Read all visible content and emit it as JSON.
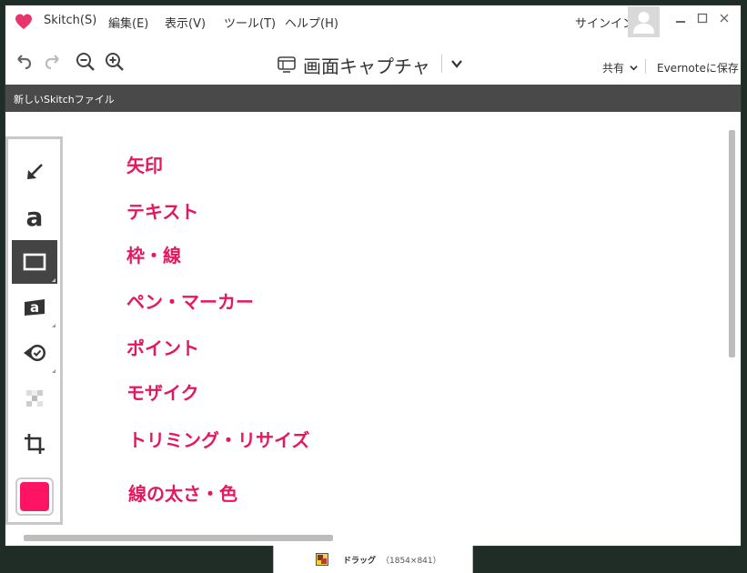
{
  "menubar": {
    "items": [
      "Skitch(S)",
      "編集(E)",
      "表示(V)",
      "ツール(T)",
      "ヘルプ(H)"
    ],
    "signin": "サインイン"
  },
  "toolbar": {
    "mode_title": "画面キャプチャ",
    "share": "共有",
    "save": "Evernoteに保存"
  },
  "tab": {
    "label": "新しいSkitchファイル"
  },
  "annotations": [
    "矢印",
    "テキスト",
    "枠・線",
    "ペン・マーカー",
    "ポイント",
    "モザイク",
    "トリミング・リサイズ",
    "線の太さ・色"
  ],
  "status": {
    "label": "ドラッグ",
    "size": "（1854×841）"
  },
  "colors": {
    "accent": "#e6175f",
    "selected_color": "#ff1464",
    "tabbar": "#494949"
  }
}
